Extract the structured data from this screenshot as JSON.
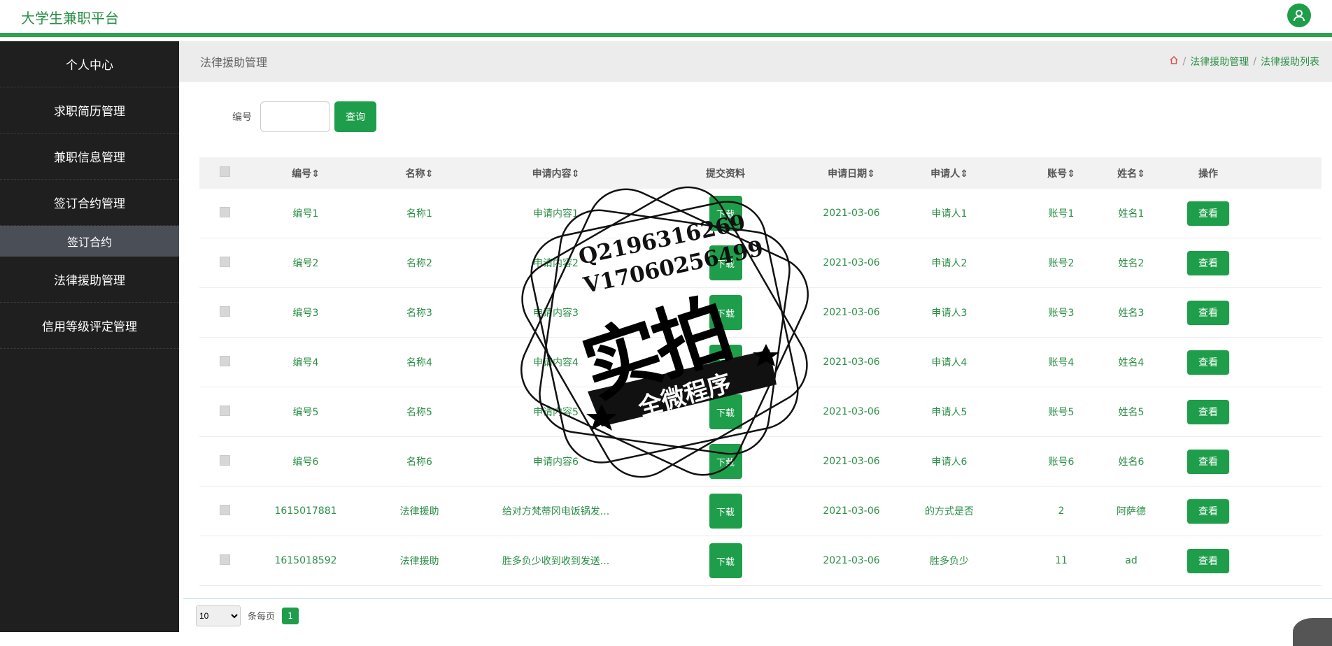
{
  "app": {
    "title": "大学生兼职平台"
  },
  "sidebar": {
    "items": [
      {
        "label": "个人中心"
      },
      {
        "label": "求职简历管理"
      },
      {
        "label": "兼职信息管理"
      },
      {
        "label": "签订合约管理"
      },
      {
        "label": "签订合约",
        "sub": true
      },
      {
        "label": "法律援助管理"
      },
      {
        "label": "信用等级评定管理"
      }
    ]
  },
  "header": {
    "title": "法律援助管理",
    "breadcrumb": [
      "法律援助管理",
      "法律援助列表"
    ]
  },
  "search": {
    "label": "编号",
    "value": "",
    "button": "查询"
  },
  "table": {
    "columns": [
      "编号",
      "名称",
      "申请内容",
      "提交资料",
      "申请日期",
      "申请人",
      "账号",
      "姓名",
      "操作"
    ],
    "download_label": "下载",
    "view_label": "查看",
    "rows": [
      {
        "id": "编号1",
        "name": "名称1",
        "content": "申请内容1",
        "date": "2021-03-06",
        "applicant": "申请人1",
        "account": "账号1",
        "realname": "姓名1"
      },
      {
        "id": "编号2",
        "name": "名称2",
        "content": "申请内容2",
        "date": "2021-03-06",
        "applicant": "申请人2",
        "account": "账号2",
        "realname": "姓名2"
      },
      {
        "id": "编号3",
        "name": "名称3",
        "content": "申请内容3",
        "date": "2021-03-06",
        "applicant": "申请人3",
        "account": "账号3",
        "realname": "姓名3"
      },
      {
        "id": "编号4",
        "name": "名称4",
        "content": "申请内容4",
        "date": "2021-03-06",
        "applicant": "申请人4",
        "account": "账号4",
        "realname": "姓名4"
      },
      {
        "id": "编号5",
        "name": "名称5",
        "content": "申请内容5",
        "date": "2021-03-06",
        "applicant": "申请人5",
        "account": "账号5",
        "realname": "姓名5"
      },
      {
        "id": "编号6",
        "name": "名称6",
        "content": "申请内容6",
        "date": "2021-03-06",
        "applicant": "申请人6",
        "account": "账号6",
        "realname": "姓名6"
      },
      {
        "id": "1615017881",
        "name": "法律援助",
        "content": "给对方梵蒂冈电饭锅发...",
        "date": "2021-03-06",
        "applicant": "的方式是否",
        "account": "2",
        "realname": "阿萨德"
      },
      {
        "id": "1615018592",
        "name": "法律援助",
        "content": "胜多负少收到收到发送...",
        "date": "2021-03-06",
        "applicant": "胜多负少",
        "account": "11",
        "realname": "ad"
      }
    ]
  },
  "pager": {
    "page_size": "10",
    "per_page_label": "条每页",
    "current_page": "1"
  },
  "watermark": {
    "line1": "Q2196316269",
    "line2": "V17060256499",
    "main": "实拍",
    "ribbon": "全微程序"
  },
  "colors": {
    "accent": "#1e9e4a",
    "sidebar_bg": "#1f1f1f",
    "link_text": "#2b8f46"
  }
}
